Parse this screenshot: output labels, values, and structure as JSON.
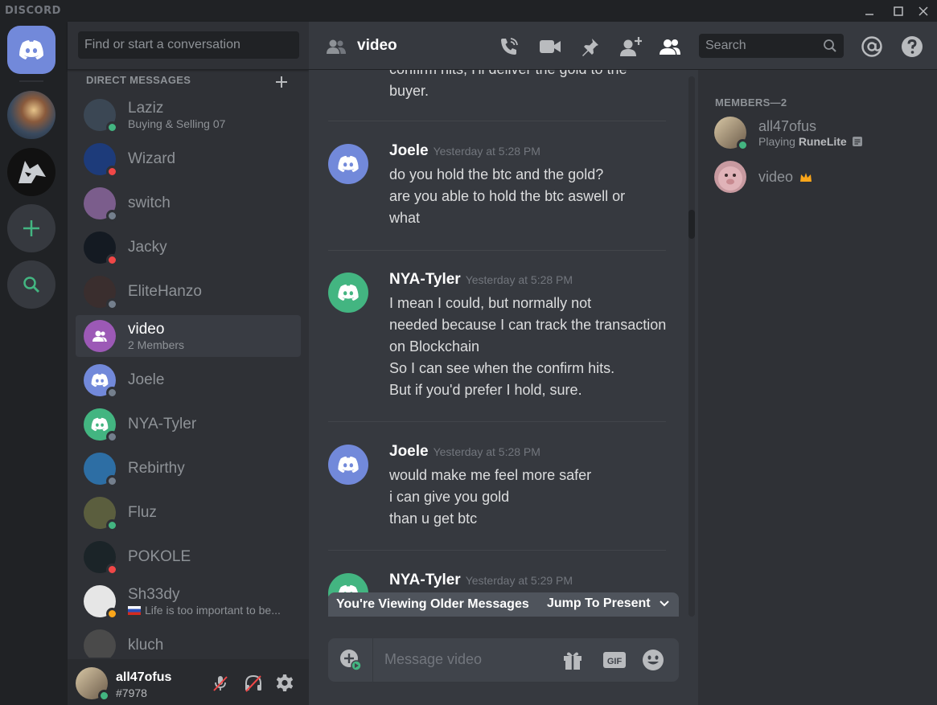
{
  "titlebar": {
    "brand": "DISCORD"
  },
  "dm": {
    "search_placeholder": "Find or start a conversation",
    "section_label": "DIRECT MESSAGES",
    "items": [
      {
        "name": "Laziz",
        "sub": "Buying & Selling 07",
        "status": "online",
        "avatar_color": "#3b4754"
      },
      {
        "name": "Wizard",
        "sub": "",
        "status": "dnd",
        "avatar_color": "#1d3b7a"
      },
      {
        "name": "switch",
        "sub": "",
        "status": "offline",
        "avatar_color": "#7b5d8c"
      },
      {
        "name": "Jacky",
        "sub": "",
        "status": "dnd",
        "avatar_color": "#141a22"
      },
      {
        "name": "EliteHanzo",
        "sub": "",
        "status": "offline",
        "avatar_color": "#3a2e2e"
      },
      {
        "name": "video",
        "sub": "2 Members",
        "status": "",
        "avatar_color": "#9c59b6"
      },
      {
        "name": "Joele",
        "sub": "",
        "status": "offline",
        "avatar_color": "#7289da"
      },
      {
        "name": "NYA-Tyler",
        "sub": "",
        "status": "offline",
        "avatar_color": "#43b581"
      },
      {
        "name": "Rebirthy",
        "sub": "",
        "status": "offline",
        "avatar_color": "#2d6ea4"
      },
      {
        "name": "Fluz",
        "sub": "",
        "status": "online",
        "avatar_color": "#5b5e3e"
      },
      {
        "name": "POKOLE",
        "sub": "",
        "status": "dnd",
        "avatar_color": "#1b2428"
      },
      {
        "name": "Sh33dy",
        "sub": "Life is too important to be...",
        "status": "idle",
        "avatar_color": "#e6e6e6"
      },
      {
        "name": "kluch",
        "sub": "",
        "status": "",
        "avatar_color": "#4a4a4a"
      }
    ]
  },
  "user": {
    "name": "all47ofus",
    "tag": "#7978"
  },
  "channel": {
    "title": "video",
    "search_placeholder": "Search"
  },
  "messages": {
    "top_fragment": [
      "confirm hits, I'll deliver the gold to the",
      "buyer."
    ],
    "groups": [
      {
        "author": "Joele",
        "time": "Yesterday at 5:28 PM",
        "avatar_color": "#7289da",
        "lines": [
          "do you hold the btc and the gold?",
          "are you able to hold the btc aswell or",
          "what"
        ]
      },
      {
        "author": "NYA-Tyler",
        "time": "Yesterday at 5:28 PM",
        "avatar_color": "#43b581",
        "lines": [
          "I mean I could, but normally not",
          "needed because I can track the transaction",
          "on Blockchain",
          "So I can see when the confirm hits.",
          "But if you'd prefer I hold, sure."
        ]
      },
      {
        "author": "Joele",
        "time": "Yesterday at 5:28 PM",
        "avatar_color": "#7289da",
        "lines": [
          "would make me feel more safer",
          "i can give you gold",
          "than u get btc"
        ]
      },
      {
        "author": "NYA-Tyler",
        "time": "Yesterday at 5:29 PM",
        "avatar_color": "#43b581",
        "lines": []
      }
    ],
    "older_notice": "You're Viewing Older Messages",
    "jump_label": "Jump To Present",
    "composer_placeholder": "Message video"
  },
  "members": {
    "label": "MEMBERS—2",
    "items": [
      {
        "name": "all47ofus",
        "activity_prefix": "Playing ",
        "activity_game": "RuneLite",
        "status": "online"
      },
      {
        "name": "video",
        "owner": true
      }
    ]
  },
  "colors": {
    "blurple": "#7289da",
    "green": "#43b581",
    "dnd": "#f04747",
    "idle": "#faa61a",
    "crown": "#faa61a"
  }
}
